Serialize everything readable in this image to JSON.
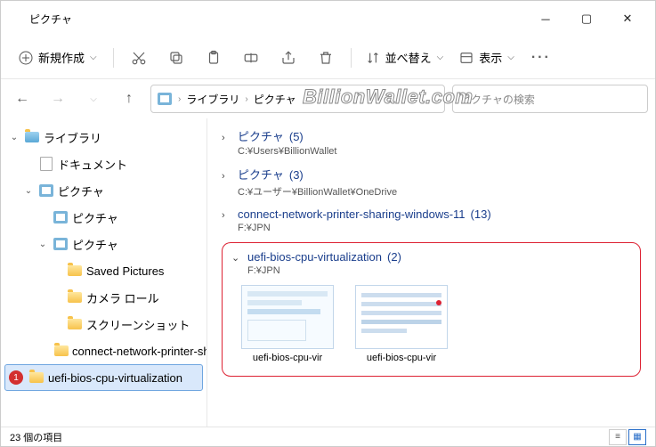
{
  "window": {
    "title": "ピクチャ"
  },
  "toolbar": {
    "new_label": "新規作成",
    "sort_label": "並べ替え",
    "view_label": "表示"
  },
  "breadcrumb": {
    "seg1": "ライブラリ",
    "seg2": "ピクチャ"
  },
  "search": {
    "placeholder": "ピクチャの検索"
  },
  "tree": {
    "libraries": "ライブラリ",
    "documents": "ドキュメント",
    "pictures": "ピクチャ",
    "pictures_sub1": "ピクチャ",
    "pictures_sub2": "ピクチャ",
    "saved_pictures": "Saved Pictures",
    "camera_roll": "カメラ ロール",
    "screenshots": "スクリーンショット",
    "connect": "connect-network-printer-shari",
    "uefi": "uefi-bios-cpu-virtualization",
    "badge": "1"
  },
  "groups": [
    {
      "title": "ピクチャ",
      "count": "(5)",
      "path": "C:¥Users¥BillionWallet"
    },
    {
      "title": "ピクチャ",
      "count": "(3)",
      "path": "C:¥ユーザー¥BillionWallet¥OneDrive"
    },
    {
      "title": "connect-network-printer-sharing-windows-11",
      "count": "(13)",
      "path": "F:¥JPN"
    },
    {
      "title": "uefi-bios-cpu-virtualization",
      "count": "(2)",
      "path": "F:¥JPN"
    }
  ],
  "thumbs": {
    "name1": "uefi-bios-cpu-vir",
    "name2": "uefi-bios-cpu-vir"
  },
  "status": {
    "count": "23 個の項目"
  },
  "watermark": "BillionWallet.com"
}
